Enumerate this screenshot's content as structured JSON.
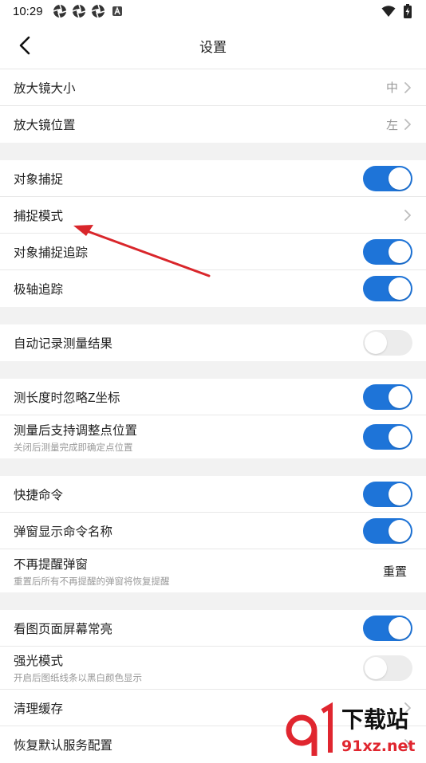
{
  "status_bar": {
    "time": "10:29",
    "left_icons": [
      "aperture-icon",
      "aperture-icon",
      "aperture-icon",
      "keyboard-a-icon"
    ],
    "right_icons": [
      "wifi-icon",
      "battery-charging-icon"
    ]
  },
  "appbar": {
    "title": "设置"
  },
  "groups": [
    {
      "rows": [
        {
          "id": "magnifier-size",
          "label": "放大镜大小",
          "kind": "nav",
          "value": "中"
        },
        {
          "id": "magnifier-position",
          "label": "放大镜位置",
          "kind": "nav",
          "value": "左"
        }
      ]
    },
    {
      "rows": [
        {
          "id": "object-snap",
          "label": "对象捕捉",
          "kind": "toggle",
          "on": true
        },
        {
          "id": "snap-mode",
          "label": "捕捉模式",
          "kind": "nav",
          "value": ""
        },
        {
          "id": "object-snap-tracking",
          "label": "对象捕捉追踪",
          "kind": "toggle",
          "on": true
        },
        {
          "id": "polar-tracking",
          "label": "极轴追踪",
          "kind": "toggle",
          "on": true
        }
      ]
    },
    {
      "rows": [
        {
          "id": "auto-record-measure",
          "label": "自动记录测量结果",
          "kind": "toggle",
          "on": false
        }
      ]
    },
    {
      "rows": [
        {
          "id": "ignore-z",
          "label": "测长度时忽略Z坐标",
          "kind": "toggle",
          "on": true
        },
        {
          "id": "adjust-point",
          "label": "测量后支持调整点位置",
          "sub": "关闭后测量完成即确定点位置",
          "kind": "toggle",
          "on": true
        }
      ]
    },
    {
      "rows": [
        {
          "id": "quick-command",
          "label": "快捷命令",
          "kind": "toggle",
          "on": true
        },
        {
          "id": "popup-command-name",
          "label": "弹窗显示命令名称",
          "kind": "toggle",
          "on": true
        },
        {
          "id": "no-remind-popup",
          "label": "不再提醒弹窗",
          "sub": "重置后所有不再提醒的弹窗将恢复提醒",
          "kind": "action",
          "action": "重置"
        }
      ]
    },
    {
      "rows": [
        {
          "id": "screen-always-on",
          "label": "看图页面屏幕常亮",
          "kind": "toggle",
          "on": true
        },
        {
          "id": "high-light-mode",
          "label": "强光模式",
          "sub": "开启后图纸线条以黑白颜色显示",
          "kind": "toggle",
          "on": false
        },
        {
          "id": "clear-cache",
          "label": "清理缓存",
          "kind": "nav",
          "value": ""
        },
        {
          "id": "restore-default-service",
          "label": "恢复默认服务配置",
          "kind": "nav",
          "value": ""
        }
      ]
    }
  ],
  "watermark": {
    "brand": "下载站",
    "url": "91xz.net"
  },
  "colors": {
    "toggle_on": "#1e74d8",
    "toggle_off": "#ececec",
    "arrow": "#d9262b",
    "watermark": "#e0262f"
  }
}
